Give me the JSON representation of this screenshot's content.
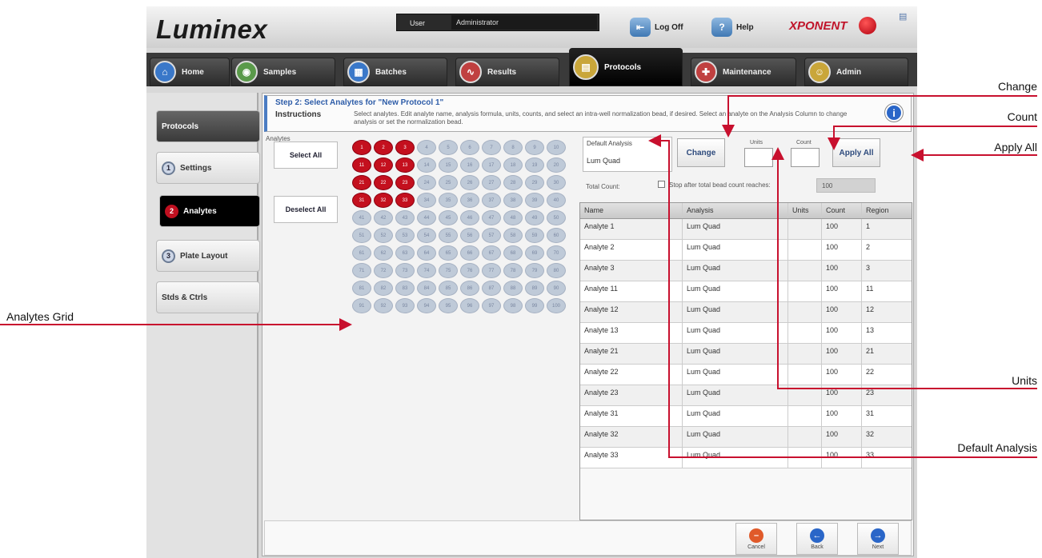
{
  "app": {
    "logo": "Luminex",
    "brand": "XPONENT"
  },
  "topbar": {
    "user_label": "User",
    "user_value": "Administrator",
    "logoff_label": "Log Off",
    "help_label": "Help"
  },
  "tabs": [
    {
      "label": "Home",
      "icon": "home-icon",
      "color": "#3a78c9"
    },
    {
      "label": "Samples",
      "icon": "samples-icon",
      "color": "#5a9a4a"
    },
    {
      "label": "Batches",
      "icon": "batches-icon",
      "color": "#3a78c9"
    },
    {
      "label": "Results",
      "icon": "results-icon",
      "color": "#c04040"
    },
    {
      "label": "Protocols",
      "icon": "protocols-icon",
      "color": "#c9a63a"
    },
    {
      "label": "Maintenance",
      "icon": "maintenance-icon",
      "color": "#c04040"
    },
    {
      "label": "Admin",
      "icon": "admin-icon",
      "color": "#c9a63a"
    }
  ],
  "sidebar": {
    "items": [
      {
        "label": "Protocols",
        "num": ""
      },
      {
        "label": "Settings",
        "num": "1"
      },
      {
        "label": "Analytes",
        "num": "2"
      },
      {
        "label": "Plate Layout",
        "num": "3"
      },
      {
        "label": "Stds & Ctrls",
        "num": ""
      }
    ]
  },
  "main": {
    "step_title": "Step 2: Select Analytes for \"New Protocol 1\"",
    "instructions_label": "Instructions",
    "instructions_text": "Select analytes. Edit analyte name, analysis formula, units, counts, and select an intra-well normalization bead, if desired. Select an analyte on the Analysis Column to change analysis or set the normalization bead.",
    "analytes_label": "Analytes",
    "select_all": "Select All",
    "deselect_all": "Deselect All",
    "default_analysis_label": "Default Analysis",
    "default_analysis_value": "Lum Quad",
    "change_label": "Change",
    "units_label": "Units",
    "count_label": "Count",
    "apply_all_label": "Apply All",
    "total_count_label": "Total Count:",
    "stop_label": "Stop after total bead count reaches:",
    "stop_value": "100"
  },
  "bead_grid": {
    "total": 100,
    "selected": [
      1,
      2,
      3,
      11,
      12,
      13,
      21,
      22,
      23,
      31,
      32,
      33
    ]
  },
  "table": {
    "headers": [
      "Name",
      "Analysis",
      "Units",
      "Count",
      "Region"
    ],
    "rows": [
      [
        "Analyte 1",
        "Lum Quad",
        "",
        "100",
        "1"
      ],
      [
        "Analyte 2",
        "Lum Quad",
        "",
        "100",
        "2"
      ],
      [
        "Analyte 3",
        "Lum Quad",
        "",
        "100",
        "3"
      ],
      [
        "Analyte 11",
        "Lum Quad",
        "",
        "100",
        "11"
      ],
      [
        "Analyte 12",
        "Lum Quad",
        "",
        "100",
        "12"
      ],
      [
        "Analyte 13",
        "Lum Quad",
        "",
        "100",
        "13"
      ],
      [
        "Analyte 21",
        "Lum Quad",
        "",
        "100",
        "21"
      ],
      [
        "Analyte 22",
        "Lum Quad",
        "",
        "100",
        "22"
      ],
      [
        "Analyte 23",
        "Lum Quad",
        "",
        "100",
        "23"
      ],
      [
        "Analyte 31",
        "Lum Quad",
        "",
        "100",
        "31"
      ],
      [
        "Analyte 32",
        "Lum Quad",
        "",
        "100",
        "32"
      ],
      [
        "Analyte 33",
        "Lum Quad",
        "",
        "100",
        "33"
      ]
    ]
  },
  "footer": {
    "cancel": "Cancel",
    "back": "Back",
    "next": "Next"
  },
  "callouts": {
    "change": "Change",
    "count": "Count",
    "apply_all": "Apply All",
    "analytes_grid": "Analytes Grid",
    "units": "Units",
    "default_analysis": "Default Analysis"
  },
  "colors": {
    "accent_red": "#c4101e",
    "arrow": "#c8102e",
    "title_blue": "#2d5ca8"
  }
}
